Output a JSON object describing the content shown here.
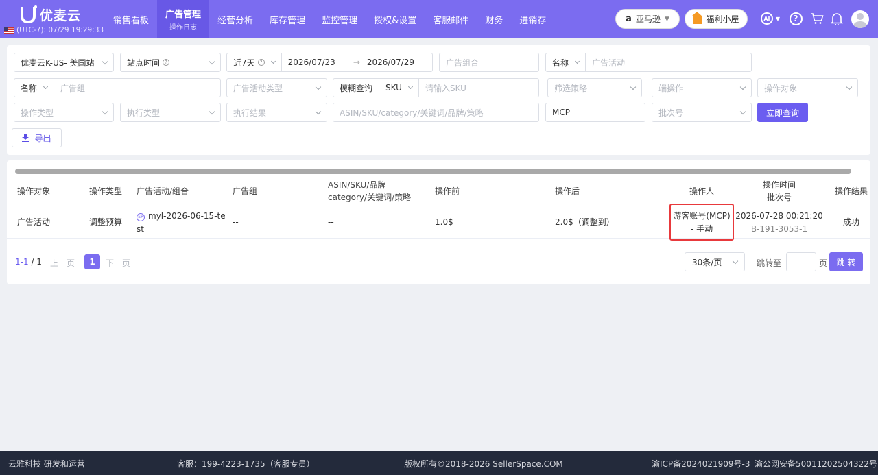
{
  "header": {
    "logo_text": "优麦云",
    "timezone": "(UTC-7): 07/29 19:29:33",
    "nav": [
      {
        "label": "销售看板"
      },
      {
        "label": "广告管理",
        "sub": "操作日志"
      },
      {
        "label": "经营分析"
      },
      {
        "label": "库存管理"
      },
      {
        "label": "监控管理"
      },
      {
        "label": "授权&设置"
      },
      {
        "label": "客服邮件"
      },
      {
        "label": "财务"
      },
      {
        "label": "进销存"
      }
    ],
    "marketplace_logo": "a",
    "marketplace": "亚马逊",
    "gift_label": "福利小屋",
    "ai_label": "AI",
    "icons": [
      "ai-icon",
      "help-icon",
      "cart-icon",
      "bell-icon",
      "avatar"
    ]
  },
  "filters": {
    "shop": "优麦云K-US- 美国站",
    "time_type": "站点时间",
    "range_preset": "近7天",
    "date_start": "2026/07/23",
    "date_end": "2026/07/29",
    "ad_group_combo_ph": "广告组合",
    "name_select_1": "名称",
    "campaign_ph": "广告活动",
    "name_select_2": "名称",
    "ad_group_ph": "广告组",
    "campaign_type_ph": "广告活动类型",
    "match_mode": "模糊查询",
    "sku_select": "SKU",
    "sku_ph": "请输入SKU",
    "strategy_ph": "筛选策略",
    "endpoint_ph": "端操作",
    "target_ph": "操作对象",
    "op_type_ph": "操作类型",
    "exec_type_ph": "执行类型",
    "exec_result_ph": "执行结果",
    "keyword_ph": "ASIN/SKU/category/关键词/品牌/策略",
    "operator_value": "MCP",
    "batch_ph": "批次号",
    "query_button": "立即查询",
    "export_button": "导出"
  },
  "table": {
    "columns": [
      "操作对象",
      "操作类型",
      "广告活动/组合",
      "广告组",
      "ASIN/SKU/品牌",
      "category/关键词/策略",
      "操作前",
      "操作后",
      "操作人",
      "操作时间",
      "批次号",
      "操作结果"
    ],
    "rows": [
      {
        "target": "广告活动",
        "op_type": "调整预算",
        "campaign_badge": "SP",
        "campaign": "myl-2026-06-15-test",
        "ad_group": "--",
        "asin": "--",
        "before": "1.0$",
        "after": "2.0$（调整到）",
        "operator_line1": "游客账号(MCP)",
        "operator_line2": "- 手动",
        "time": "2026-07-28 00:21:20",
        "batch": "B-191-3053-1",
        "result": "成功"
      }
    ]
  },
  "pagination": {
    "range": "1-1",
    "total_pages": "/ 1",
    "prev": "上一页",
    "current": "1",
    "next": "下一页",
    "per_page": "30条/页",
    "jump_to": "跳转至",
    "page_unit": "页",
    "jump_button": "跳 转"
  },
  "footer": {
    "company": "云雅科技 研发和运营",
    "service": "客服：199-4223-1735（客服专员）",
    "copyright": "版权所有©2018-2026 SellerSpace.COM",
    "icp": "渝ICP备2024021909号-3",
    "police": "渝公网安备50011202504322号"
  },
  "colors": {
    "brand": "#7b6cf0",
    "highlight": "#e8393c",
    "footer_bg": "#232a3b"
  }
}
